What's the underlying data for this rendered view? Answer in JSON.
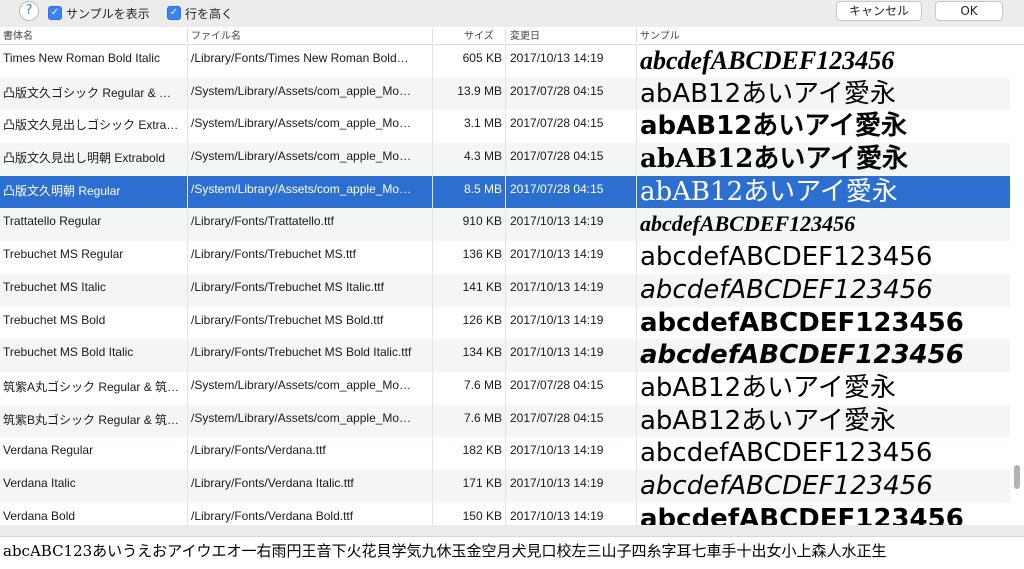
{
  "toolbar": {
    "help_label": "?",
    "show_sample_label": "サンプルを表示",
    "show_sample_checked": "✓",
    "tall_rows_label": "行を高く",
    "tall_rows_checked": "✓",
    "cancel_label": "キャンセル",
    "ok_label": "OK"
  },
  "table": {
    "headers": {
      "name": "書体名",
      "path": "ファイル名",
      "size": "サイズ",
      "date": "変更日",
      "sample": "サンプル"
    },
    "rows": [
      {
        "name": "Times New Roman Bold Italic",
        "path": "/Library/Fonts/Times New Roman Bold…",
        "size": "605 KB",
        "date": "2017/10/13 14:19",
        "sample": "abcdefABCDEF123456"
      },
      {
        "name": "凸版文久ゴシック Regular & 凸…",
        "path": "/System/Library/Assets/com_apple_Mo…",
        "size": "13.9 MB",
        "date": "2017/07/28 04:15",
        "sample": "abAB12あいアイ愛永"
      },
      {
        "name": "凸版文久見出しゴシック Extrabold",
        "path": "/System/Library/Assets/com_apple_Mo…",
        "size": "3.1 MB",
        "date": "2017/07/28 04:15",
        "sample": "abAB12あいアイ愛永"
      },
      {
        "name": "凸版文久見出し明朝 Extrabold",
        "path": "/System/Library/Assets/com_apple_Mo…",
        "size": "4.3 MB",
        "date": "2017/07/28 04:15",
        "sample": "abAB12あいアイ愛永"
      },
      {
        "name": "凸版文久明朝 Regular",
        "path": "/System/Library/Assets/com_apple_Mo…",
        "size": "8.5 MB",
        "date": "2017/07/28 04:15",
        "sample": "abAB12あいアイ愛永"
      },
      {
        "name": "Trattatello Regular",
        "path": "/Library/Fonts/Trattatello.ttf",
        "size": "910 KB",
        "date": "2017/10/13 14:19",
        "sample": "abcdefABCDEF123456"
      },
      {
        "name": "Trebuchet MS Regular",
        "path": "/Library/Fonts/Trebuchet MS.ttf",
        "size": "136 KB",
        "date": "2017/10/13 14:19",
        "sample": "abcdefABCDEF123456"
      },
      {
        "name": "Trebuchet MS Italic",
        "path": "/Library/Fonts/Trebuchet MS Italic.ttf",
        "size": "141 KB",
        "date": "2017/10/13 14:19",
        "sample": "abcdefABCDEF123456"
      },
      {
        "name": "Trebuchet MS Bold",
        "path": "/Library/Fonts/Trebuchet MS Bold.ttf",
        "size": "126 KB",
        "date": "2017/10/13 14:19",
        "sample": "abcdefABCDEF123456"
      },
      {
        "name": "Trebuchet MS Bold Italic",
        "path": "/Library/Fonts/Trebuchet MS Bold Italic.ttf",
        "size": "134 KB",
        "date": "2017/10/13 14:19",
        "sample": "abcdefABCDEF123456"
      },
      {
        "name": "筑紫A丸ゴシック Regular & 筑…",
        "path": "/System/Library/Assets/com_apple_Mo…",
        "size": "7.6 MB",
        "date": "2017/07/28 04:15",
        "sample": "abAB12あいアイ愛永"
      },
      {
        "name": "筑紫B丸ゴシック Regular & 筑…",
        "path": "/System/Library/Assets/com_apple_Mo…",
        "size": "7.6 MB",
        "date": "2017/07/28 04:15",
        "sample": "abAB12あいアイ愛永"
      },
      {
        "name": "Verdana Regular",
        "path": "/Library/Fonts/Verdana.ttf",
        "size": "182 KB",
        "date": "2017/10/13 14:19",
        "sample": "abcdefABCDEF123456"
      },
      {
        "name": "Verdana Italic",
        "path": "/Library/Fonts/Verdana Italic.ttf",
        "size": "171 KB",
        "date": "2017/10/13 14:19",
        "sample": "abcdefABCDEF123456"
      },
      {
        "name": "Verdana Bold",
        "path": "/Library/Fonts/Verdana Bold.ttf",
        "size": "150 KB",
        "date": "2017/10/13 14:19",
        "sample": "abcdefABCDEF123456"
      }
    ],
    "selected_index": 4
  },
  "preview": {
    "text": "abcABC123あいうえおアイウエオ一右雨円王音下火花貝学気九休玉金空月犬見口校左三山子四糸字耳七車手十出女小上森人水正生"
  },
  "colors": {
    "selection": "#2d6fd1",
    "checkbox": "#3b82f7"
  }
}
